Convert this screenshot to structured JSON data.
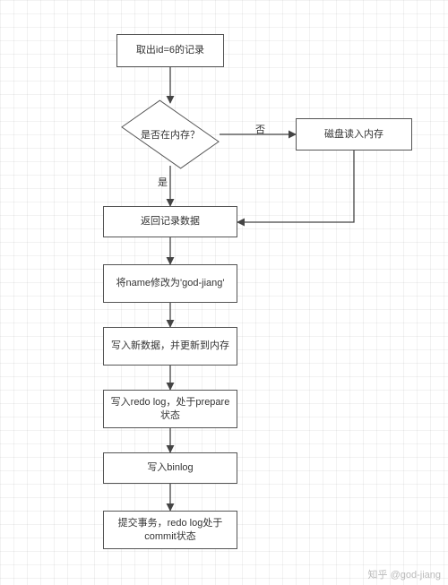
{
  "chart_data": {
    "type": "flowchart",
    "title": "",
    "nodes": [
      {
        "id": "n1",
        "type": "process",
        "label": "取出id=6的记录"
      },
      {
        "id": "n2",
        "type": "decision",
        "label": "是否在内存？"
      },
      {
        "id": "n3",
        "type": "process",
        "label": "磁盘读入内存"
      },
      {
        "id": "n4",
        "type": "process",
        "label": "返回记录数据"
      },
      {
        "id": "n5",
        "type": "process",
        "label": "将name修改为'god-jiang'"
      },
      {
        "id": "n6",
        "type": "process",
        "label": "写入新数据，并更新到内存"
      },
      {
        "id": "n7",
        "type": "process",
        "label": "写入redo log，处于prepare状态"
      },
      {
        "id": "n8",
        "type": "process",
        "label": "写入binlog"
      },
      {
        "id": "n9",
        "type": "process",
        "label": "提交事务，redo log处于commit状态"
      }
    ],
    "edges": [
      {
        "from": "n1",
        "to": "n2",
        "label": ""
      },
      {
        "from": "n2",
        "to": "n3",
        "label": "否"
      },
      {
        "from": "n2",
        "to": "n4",
        "label": "是"
      },
      {
        "from": "n3",
        "to": "n4",
        "label": ""
      },
      {
        "from": "n4",
        "to": "n5",
        "label": ""
      },
      {
        "from": "n5",
        "to": "n6",
        "label": ""
      },
      {
        "from": "n6",
        "to": "n7",
        "label": ""
      },
      {
        "from": "n7",
        "to": "n8",
        "label": ""
      },
      {
        "from": "n8",
        "to": "n9",
        "label": ""
      }
    ],
    "edge_labels": {
      "yes": "是",
      "no": "否"
    }
  },
  "watermark": "知乎 @god-jiang"
}
